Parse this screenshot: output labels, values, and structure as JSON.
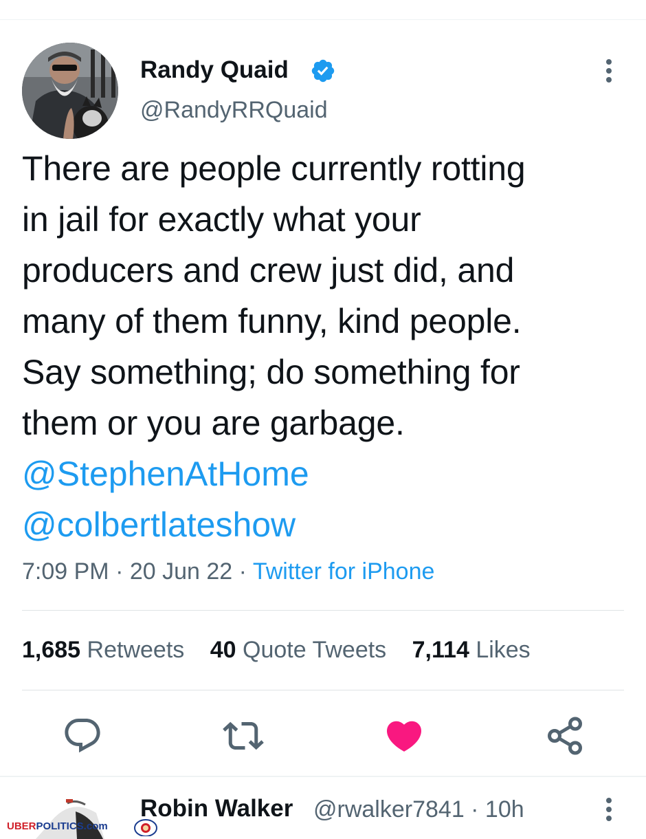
{
  "tweet": {
    "author": {
      "display_name": "Randy Quaid",
      "handle": "@RandyRRQuaid",
      "verified": true
    },
    "text": "There are people currently rotting\nin jail for exactly what your\nproducers and crew just did, and\nmany of them funny, kind people.\nSay something; do something for\nthem or you are garbage.",
    "mentions": [
      "@StephenAtHome",
      "@colbertlateshow"
    ],
    "time": "7:09 PM",
    "separator": "·",
    "date": "20 Jun 22",
    "source": "Twitter for iPhone",
    "stats": {
      "retweets_count": "1,685",
      "retweets_label": "Retweets",
      "quotes_count": "40",
      "quotes_label": "Quote Tweets",
      "likes_count": "7,114",
      "likes_label": "Likes"
    },
    "actions": {
      "reply_icon": "reply-icon",
      "retweet_icon": "retweet-icon",
      "like_icon": "heart-filled-icon",
      "share_icon": "share-icon",
      "liked": true
    }
  },
  "reply": {
    "display_name": "Robin Walker",
    "handle_time": "@rwalker7841 · 10h"
  },
  "watermark": {
    "part1": "UBER",
    "part2": "POLITICS.com"
  },
  "colors": {
    "accent": "#1d9bf0",
    "like": "#f91880",
    "text": "#0f1419",
    "secondary": "#536471"
  }
}
